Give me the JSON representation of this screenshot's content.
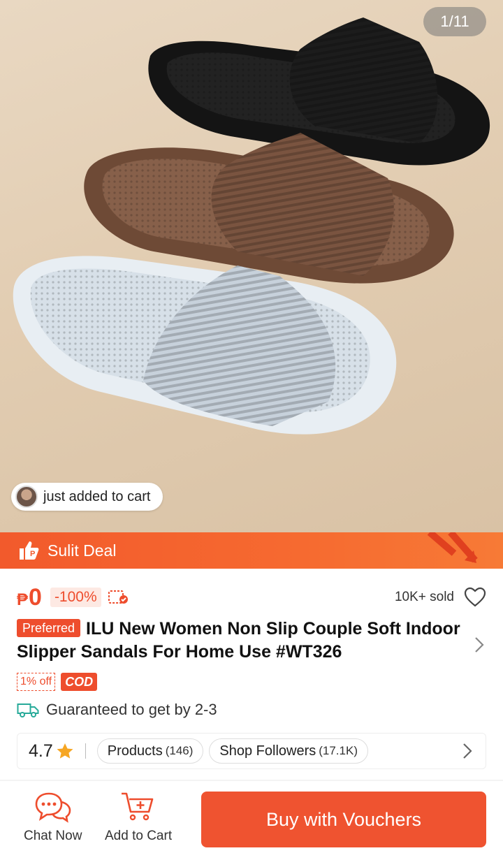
{
  "gallery": {
    "counter": "1/11",
    "toast_text": "just added to cart"
  },
  "deal_banner": {
    "label": "Sulit Deal"
  },
  "price": {
    "currency": "₱",
    "amount": "0",
    "discount": "-100%",
    "sold": "10K+ sold"
  },
  "product": {
    "badge": "Preferred",
    "title": "ILU New Women Non Slip Couple Soft Indoor Slipper Sandals For Home Use #WT326",
    "off_tag": "1% off",
    "cod_tag": "COD"
  },
  "shipping": {
    "text": "Guaranteed to get by 2-3"
  },
  "shop": {
    "rating": "4.7",
    "products_label": "Products",
    "products_count": "(146)",
    "followers_label": "Shop Followers",
    "followers_count": "(17.1K)"
  },
  "bottom_bar": {
    "chat_label": "Chat Now",
    "cart_label": "Add to Cart",
    "buy_label": "Buy with Vouchers"
  },
  "colors": {
    "accent": "#ee4d2d",
    "buy_button": "#ef5330",
    "star": "#f6a623"
  },
  "icons": [
    "preferred-deal-icon",
    "voucher-tag-icon",
    "heart-icon",
    "chevron-right-icon",
    "truck-icon",
    "star-icon",
    "chat-icon",
    "cart-icon"
  ]
}
